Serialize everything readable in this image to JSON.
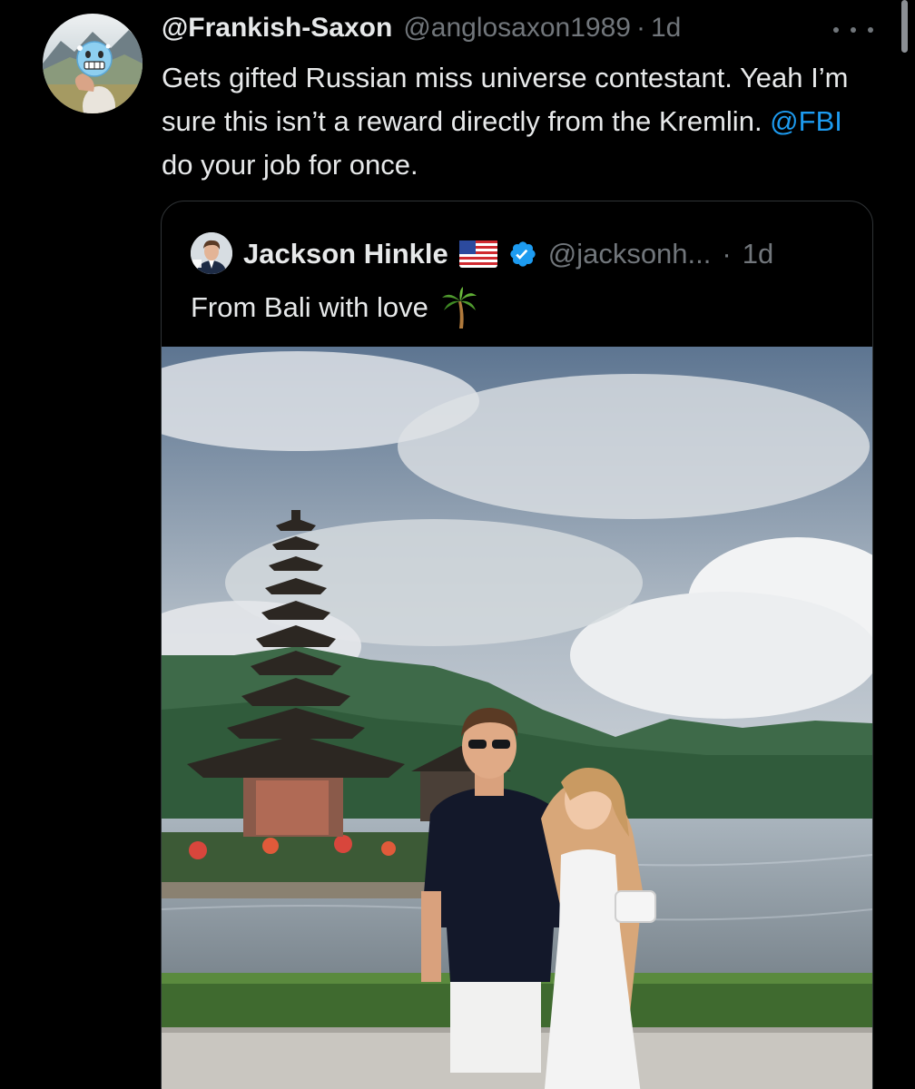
{
  "tweet": {
    "display_name": "@Frankish-Saxon",
    "handle": "@anglosaxon1989",
    "separator": "·",
    "time": "1d",
    "text_part1": "Gets gifted Russian miss universe contestant. Yeah I’m sure this isn’t a reward directly from the Kremlin. ",
    "mention": "@FBI",
    "text_part2": " do your job for once.",
    "avatar_icon": "cold-face-emoji-avatar",
    "more_icon": "more-options-icon"
  },
  "quote": {
    "display_name": "Jackson Hinkle",
    "flag_icon": "us-flag-icon",
    "verified_icon": "verified-badge-icon",
    "handle": "@jacksonh...",
    "separator": "·",
    "time": "1d",
    "text": "From Bali with love",
    "text_icon": "palm-tree-icon",
    "photo_icon": "photo-couple-at-bali-temple-lake"
  },
  "colors": {
    "background": "#000000",
    "text": "#e7e9ea",
    "secondary": "#71767b",
    "link": "#1d9bf0",
    "border": "#2f3336"
  }
}
